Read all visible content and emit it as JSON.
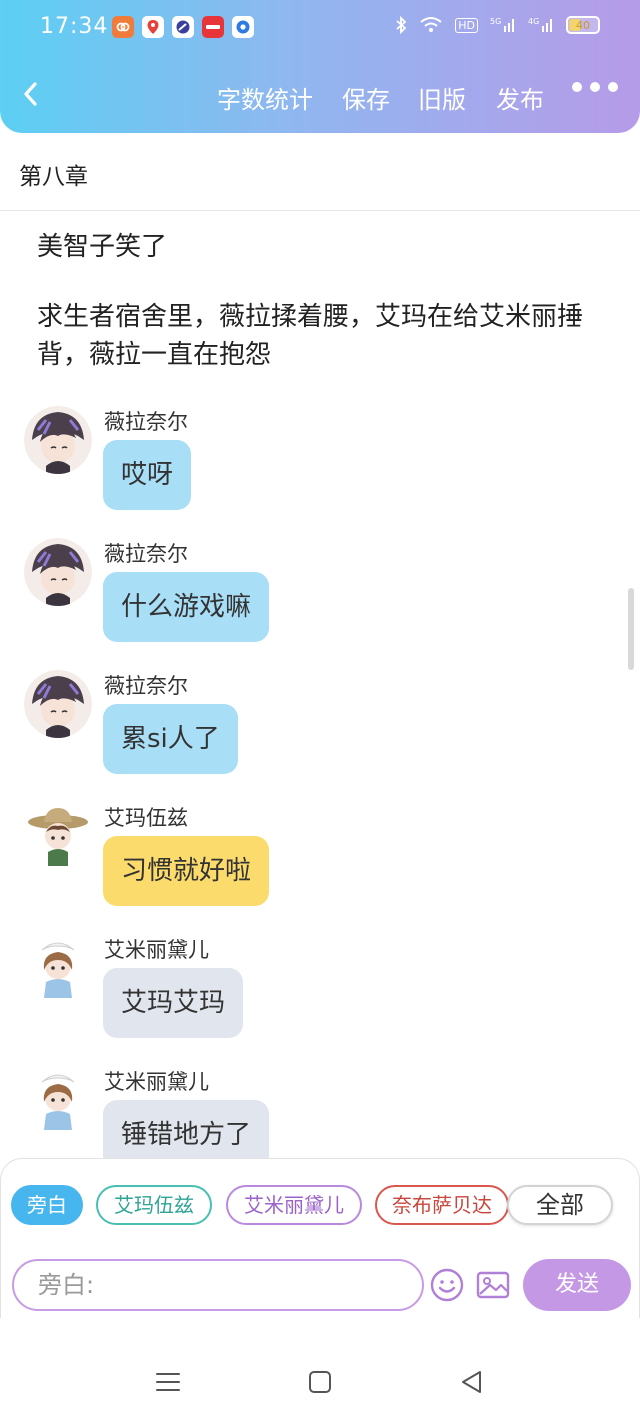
{
  "status_bar": {
    "time": "17:34",
    "battery": "40",
    "network": "HD"
  },
  "toolbar": {
    "word_count": "字数统计",
    "save": "保存",
    "old_version": "旧版",
    "publish": "发布"
  },
  "chapter": {
    "title": "第八章"
  },
  "narrations": [
    "美智子笑了",
    "求生者宿舍里，薇拉揉着腰，艾玛在给艾米丽捶背，薇拉一直在抱怨"
  ],
  "messages": [
    {
      "name": "薇拉奈尔",
      "text": "哎呀",
      "style": "blue"
    },
    {
      "name": "薇拉奈尔",
      "text": "什么游戏嘛",
      "style": "blue"
    },
    {
      "name": "薇拉奈尔",
      "text": "累si人了",
      "style": "blue"
    },
    {
      "name": "艾玛伍兹",
      "text": "习惯就好啦",
      "style": "yellow"
    },
    {
      "name": "艾米丽黛儿",
      "text": "艾玛艾玛",
      "style": "grey"
    },
    {
      "name": "艾米丽黛儿",
      "text": "锤错地方了",
      "style": "grey"
    }
  ],
  "characters": {
    "narrator": "旁白",
    "emma": "艾玛伍兹",
    "emily": "艾米丽黛儿",
    "naib": "奈布萨贝达",
    "all": "全部"
  },
  "composer": {
    "placeholder": "旁白:",
    "send": "发送"
  },
  "colors": {
    "header_start": "#5ccff2",
    "header_end": "#b69be8",
    "bubble_blue": "#a9def7",
    "bubble_yellow": "#fbdb6c",
    "bubble_grey": "#e1e6ee",
    "send": "#c598e6"
  },
  "icons": [
    "back-icon",
    "more-icon",
    "emoji-icon",
    "image-icon",
    "menu-icon",
    "home-icon",
    "back-triangle-icon"
  ]
}
